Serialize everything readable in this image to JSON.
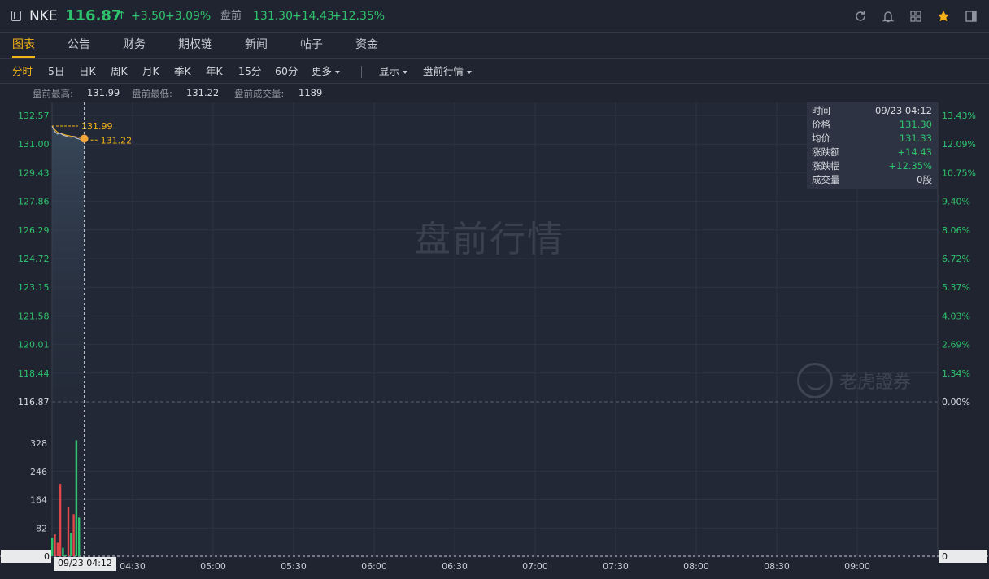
{
  "header": {
    "symbol": "NKE",
    "last_price": "116.87",
    "arrow": "↑",
    "change": "+3.50",
    "change_pct": "+3.09%",
    "pre_label": "盘前",
    "pre_price": "131.30",
    "pre_change": "+14.43",
    "pre_change_pct": "+12.35%",
    "icons": [
      "refresh-icon",
      "bell-icon",
      "grid-icon",
      "star-icon",
      "sidebar-toggle-icon"
    ]
  },
  "tabs": [
    "图表",
    "公告",
    "财务",
    "期权链",
    "新闻",
    "帖子",
    "资金"
  ],
  "active_tab": "图表",
  "periods": [
    "分时",
    "5日",
    "日K",
    "周K",
    "月K",
    "季K",
    "年K",
    "15分",
    "60分",
    "更多"
  ],
  "active_period": "分时",
  "dropdowns": [
    "显示",
    "盘前行情"
  ],
  "stats": {
    "high_label": "盘前最高:",
    "high": "131.99",
    "low_label": "盘前最低:",
    "low": "131.22",
    "vol_label": "盘前成交量:",
    "vol": "1189"
  },
  "chart_data": {
    "type": "line",
    "title": "",
    "price_axis_left": [
      "132.57",
      "131.00",
      "129.43",
      "127.86",
      "126.29",
      "124.72",
      "123.15",
      "121.58",
      "120.01",
      "118.44",
      "116.87"
    ],
    "pct_axis_right": [
      "13.43%",
      "12.09%",
      "10.75%",
      "9.40%",
      "8.06%",
      "6.72%",
      "5.37%",
      "4.03%",
      "2.69%",
      "1.34%",
      "0.00%"
    ],
    "volume_axis": [
      "328",
      "246",
      "164",
      "82",
      "0"
    ],
    "volume_axis_right": "0",
    "x_ticks": [
      "04:30",
      "05:00",
      "05:30",
      "06:00",
      "06:30",
      "07:00",
      "07:30",
      "08:00",
      "08:30",
      "09:00"
    ],
    "prev_close": 116.87,
    "ylim": [
      116.87,
      132.57
    ],
    "price_series": [
      {
        "t": "04:00",
        "v": 131.99
      },
      {
        "t": "04:01",
        "v": 131.7
      },
      {
        "t": "04:02",
        "v": 131.55
      },
      {
        "t": "04:03",
        "v": 131.6
      },
      {
        "t": "04:04",
        "v": 131.5
      },
      {
        "t": "04:05",
        "v": 131.45
      },
      {
        "t": "04:06",
        "v": 131.4
      },
      {
        "t": "04:07",
        "v": 131.38
      },
      {
        "t": "04:08",
        "v": 131.42
      },
      {
        "t": "04:09",
        "v": 131.33
      },
      {
        "t": "04:10",
        "v": 131.28
      },
      {
        "t": "04:11",
        "v": 131.25
      },
      {
        "t": "04:12",
        "v": 131.3
      }
    ],
    "avg_series": [
      131.99,
      131.8,
      131.65,
      131.6,
      131.55,
      131.5,
      131.47,
      131.44,
      131.43,
      131.4,
      131.37,
      131.35,
      131.33
    ],
    "volume_series": [
      {
        "t": "04:00",
        "v": 55,
        "dir": "up"
      },
      {
        "t": "04:01",
        "v": 65,
        "dir": "down"
      },
      {
        "t": "04:02",
        "v": 40,
        "dir": "down"
      },
      {
        "t": "04:03",
        "v": 215,
        "dir": "down"
      },
      {
        "t": "04:04",
        "v": 25,
        "dir": "up"
      },
      {
        "t": "04:05",
        "v": 5,
        "dir": "up"
      },
      {
        "t": "04:06",
        "v": 145,
        "dir": "down"
      },
      {
        "t": "04:07",
        "v": 70,
        "dir": "up"
      },
      {
        "t": "04:08",
        "v": 125,
        "dir": "down"
      },
      {
        "t": "04:09",
        "v": 345,
        "dir": "up"
      },
      {
        "t": "04:10",
        "v": 115,
        "dir": "up"
      }
    ],
    "vol_ylim": [
      0,
      370
    ],
    "session_start": "04:00",
    "session_end": "09:30",
    "markers": {
      "high": "131.99",
      "low": "131.22"
    },
    "crosshair_time": "09/23 04:12",
    "colors": {
      "up": "#2fc26c",
      "down": "#e2474b",
      "price_line": "#b7bcc6",
      "avg_line": "#f5b317",
      "accent": "#f5b317"
    }
  },
  "tooltip": {
    "rows": [
      {
        "label": "时间",
        "value": "09/23 04:12",
        "tone": "plain"
      },
      {
        "label": "价格",
        "value": "131.30",
        "tone": "green"
      },
      {
        "label": "均价",
        "value": "131.33",
        "tone": "green"
      },
      {
        "label": "涨跌额",
        "value": "+14.43",
        "tone": "green"
      },
      {
        "label": "涨跌幅",
        "value": "+12.35%",
        "tone": "green"
      },
      {
        "label": "成交量",
        "value": "0股",
        "tone": "plain"
      }
    ]
  },
  "watermark": "盘前行情",
  "brand": "老虎證券"
}
